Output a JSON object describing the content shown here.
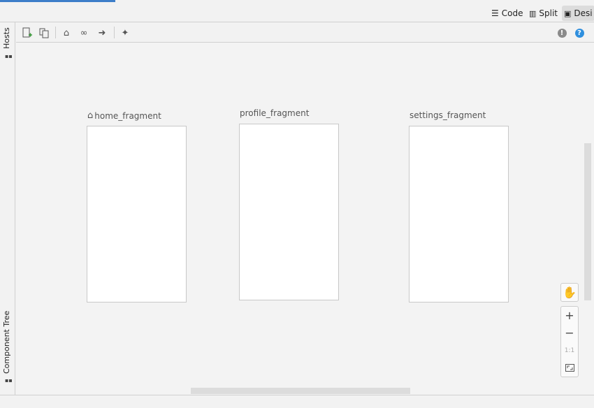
{
  "editor_modes": [
    {
      "label": "Code",
      "icon": "lines-icon"
    },
    {
      "label": "Split",
      "icon": "split-icon"
    },
    {
      "label": "Desi",
      "icon": "image-icon",
      "selected": true
    }
  ],
  "side_tabs": {
    "hosts": "Hosts",
    "component_tree": "Component Tree"
  },
  "toolbar": {
    "new_destination": "new-destination-icon",
    "duplicate": "duplicate-icon",
    "home": "home-icon",
    "link": "link-icon",
    "action": "arrow-right-icon",
    "auto_arrange": "sparkle-icon",
    "warnings": "!",
    "help": "?"
  },
  "fragments": [
    {
      "name": "home_fragment",
      "start": true
    },
    {
      "name": "profile_fragment"
    },
    {
      "name": "settings_fragment"
    }
  ],
  "zoom_panel": {
    "pan": "hand-icon",
    "zoom_in": "+",
    "zoom_out": "−",
    "actual_size": "1:1",
    "fit": "fit-screen-icon"
  }
}
